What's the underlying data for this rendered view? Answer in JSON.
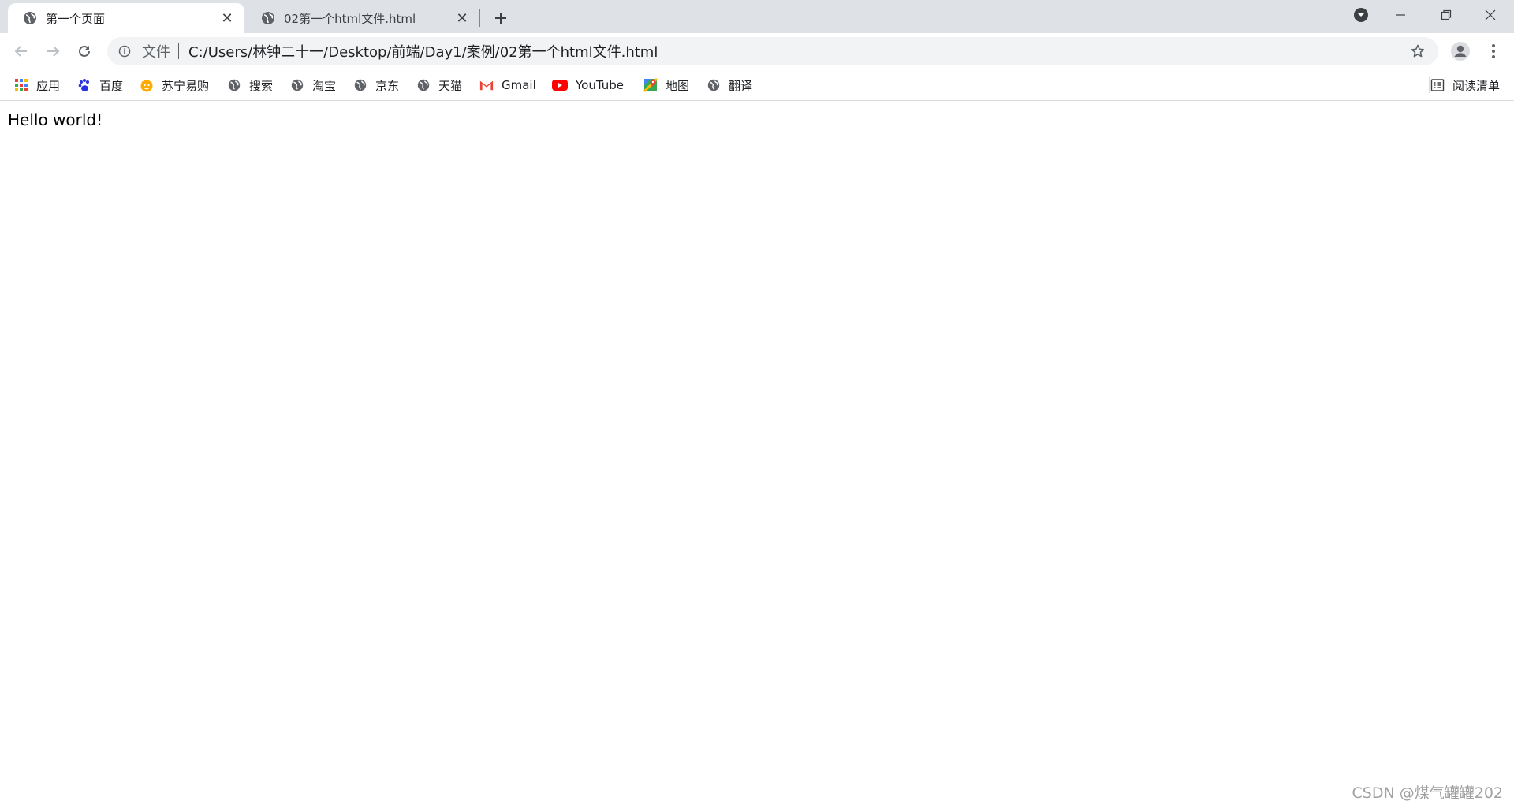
{
  "tabs": [
    {
      "title": "第一个页面",
      "active": true,
      "icon": "globe-icon"
    },
    {
      "title": "02第一个html文件.html",
      "active": false,
      "icon": "globe-icon"
    }
  ],
  "omnibox": {
    "scheme_label": "文件",
    "url": "C:/Users/林钟二十一/Desktop/前端/Day1/案例/02第一个html文件.html"
  },
  "bookmarks": [
    {
      "label": "应用",
      "icon": "apps-grid-icon"
    },
    {
      "label": "百度",
      "icon": "baidu-paw-icon"
    },
    {
      "label": "苏宁易购",
      "icon": "suning-icon"
    },
    {
      "label": "搜索",
      "icon": "globe-icon"
    },
    {
      "label": "淘宝",
      "icon": "globe-icon"
    },
    {
      "label": "京东",
      "icon": "globe-icon"
    },
    {
      "label": "天猫",
      "icon": "globe-icon"
    },
    {
      "label": "Gmail",
      "icon": "gmail-icon"
    },
    {
      "label": "YouTube",
      "icon": "youtube-icon"
    },
    {
      "label": "地图",
      "icon": "maps-icon"
    },
    {
      "label": "翻译",
      "icon": "globe-icon"
    }
  ],
  "reading_list": {
    "label": "阅读清单",
    "icon": "reading-list-icon"
  },
  "page": {
    "text": "Hello world!"
  },
  "watermark": "CSDN @煤气罐罐202",
  "colors": {
    "tabstrip": "#dee1e6",
    "omnibox": "#f1f3f4",
    "youtube_red": "#ff0000",
    "icon_gray": "#5f6368"
  }
}
